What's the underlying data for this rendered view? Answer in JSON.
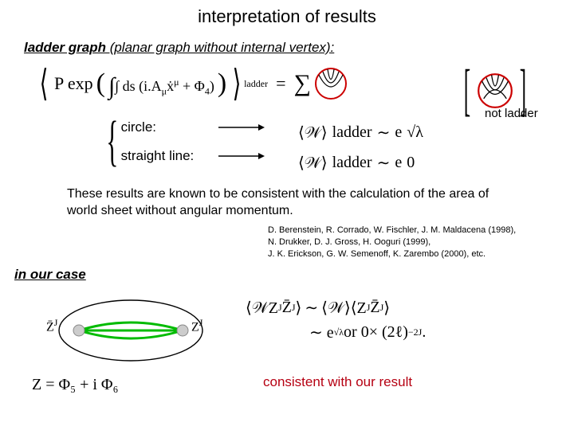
{
  "title": "interpretation of results",
  "section1": {
    "bold": "ladder graph",
    "rest": " (planar graph without internal vertex):"
  },
  "formula": {
    "lhs_main": "P exp",
    "lhs_integral": "∫ ds (i.A",
    "lhs_mu": "μ",
    "lhs_xdot": "ẋ",
    "lhs_mu2": "μ",
    "lhs_plus": " + Φ",
    "lhs_four": "4",
    "lhs_close": ")",
    "sub_label": "ladder",
    "eq": "=",
    "sigma": "∑"
  },
  "not_ladder": "not ladder",
  "cases": {
    "circle": "circle:",
    "straight": "straight line:"
  },
  "wilson": {
    "w_sym": "⟨𝒲⟩",
    "ladder_sub": "ladder",
    "sim": "∼",
    "e": "e",
    "sqrt_lambda": "√λ",
    "zero": "0"
  },
  "paragraph": "These results are known to be consistent with the calculation of the area of world sheet without angular momentum.",
  "citations": [
    "D. Berenstein, R. Corrado, W. Fischler, J. M. Maldacena (1998),",
    "N. Drukker, D. J. Gross, H. Ooguri (1999),",
    "J. K. Erickson, G. W. Semenoff, K. Zarembo (2000), etc."
  ],
  "section2": "in our case",
  "ourcase_labels": {
    "zbarJ": "Z̄",
    "zJ": "Z",
    "J": "J"
  },
  "ourcase_formula": {
    "line1_lhs": "⟨𝒲Z",
    "J": "J",
    "zbar": " Z̄",
    "rangle": "⟩",
    "sim": "∼",
    "rhs1": "⟨𝒲⟩⟨Z",
    "line2_pre": "∼ e",
    "sqrt": "√λ",
    "or0": " or 0",
    "times": " × (2ℓ)",
    "exp2J": "−2J"
  },
  "zdef": "Z = Φ₅ + i Φ₆",
  "consistent": "consistent with our result"
}
